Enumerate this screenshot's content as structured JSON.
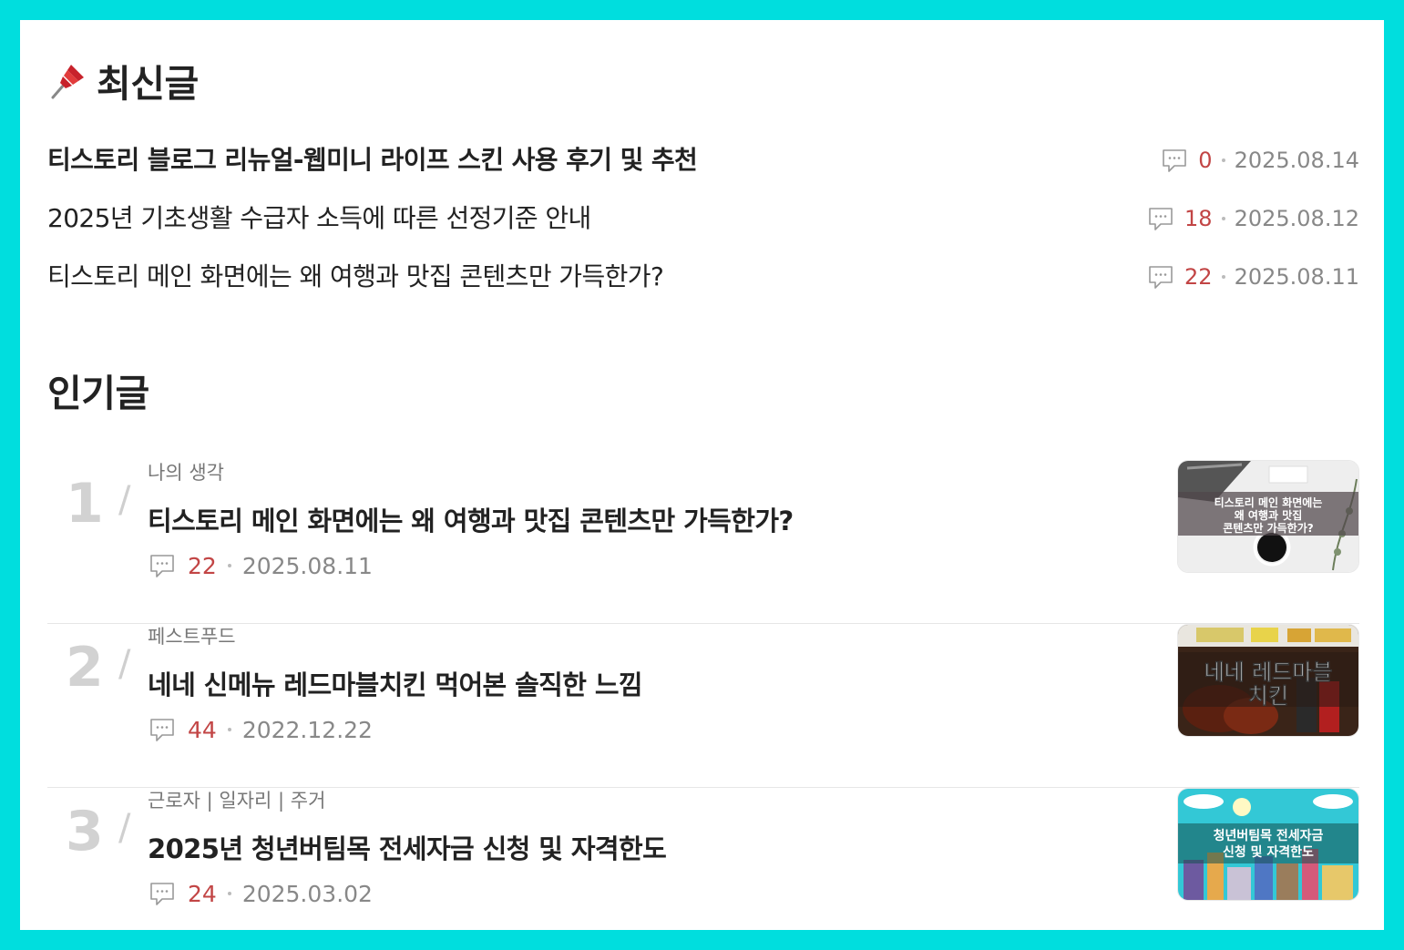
{
  "recent": {
    "title": "최신글",
    "items": [
      {
        "title": "티스토리 블로그 리뉴얼-웹미니 라이프 스킨 사용 후기 및 추천",
        "comments": "0",
        "date": "2025.08.14"
      },
      {
        "title": "2025년 기초생활 수급자 소득에 따른 선정기준 안내",
        "comments": "18",
        "date": "2025.08.12"
      },
      {
        "title": "티스토리 메인 화면에는 왜 여행과 맛집 콘텐츠만 가득한가?",
        "comments": "22",
        "date": "2025.08.11"
      }
    ]
  },
  "popular": {
    "title": "인기글",
    "items": [
      {
        "rank": "1",
        "category": "나의 생각",
        "title": "티스토리 메인 화면에는 왜 여행과 맛집 콘텐츠만 가득한가?",
        "comments": "22",
        "date": "2025.08.11",
        "thumb_text": [
          "티스토리 메인 화면에는",
          "왜 여행과 맛집",
          "콘텐츠만 가득한가?"
        ]
      },
      {
        "rank": "2",
        "category": "페스트푸드",
        "title": "네네 신메뉴 레드마블치킨 먹어본 솔직한 느낌",
        "comments": "44",
        "date": "2022.12.22",
        "thumb_text": [
          "네네 레드마블",
          "치킨"
        ]
      },
      {
        "rank": "3",
        "category": "근로자 | 일자리 | 주거",
        "title": "2025년 청년버팀목 전세자금 신청 및 자격한도",
        "comments": "24",
        "date": "2025.03.02",
        "thumb_text": [
          "청년버팀목 전세자금",
          "신청 및 자격한도"
        ]
      }
    ]
  },
  "colors": {
    "frame": "#00dede",
    "comment_count": "#c24545",
    "rank": "#d2d2d2"
  },
  "icons": {
    "section_icon": "pushpin-icon",
    "comment_icon": "comment-bubble-icon"
  }
}
